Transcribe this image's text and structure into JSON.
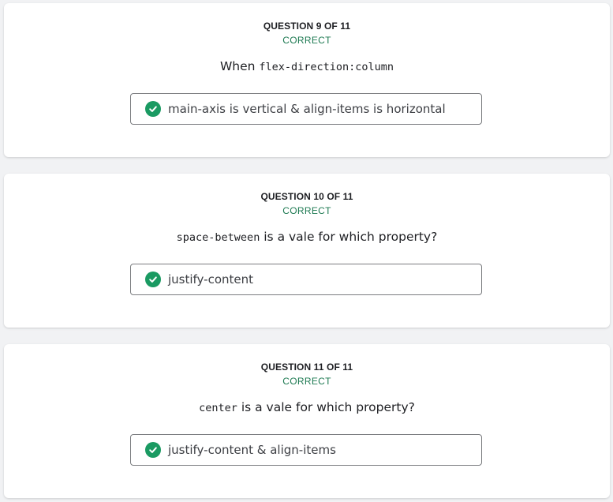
{
  "questions": [
    {
      "label": "QUESTION 9 OF 11",
      "status": "CORRECT",
      "prompt_before": "When ",
      "prompt_code": "flex-direction:column",
      "prompt_after": "",
      "answer": "main-axis is vertical & align-items is horizontal"
    },
    {
      "label": "QUESTION 10 OF 11",
      "status": "CORRECT",
      "prompt_before": "",
      "prompt_code": "space-between",
      "prompt_after": " is a vale for which property?",
      "answer": "justify-content"
    },
    {
      "label": "QUESTION 11 OF 11",
      "status": "CORRECT",
      "prompt_before": "",
      "prompt_code": "center",
      "prompt_after": " is a vale for which property?",
      "answer": "justify-content & align-items"
    }
  ],
  "colors": {
    "correct_text": "#1e7a52",
    "check_fill": "#1a9a62",
    "page_bg": "#f1f2f4",
    "card_bg": "#ffffff",
    "answer_border": "#7b7d80"
  },
  "icons": {
    "answer_check": "check-circle-icon"
  }
}
